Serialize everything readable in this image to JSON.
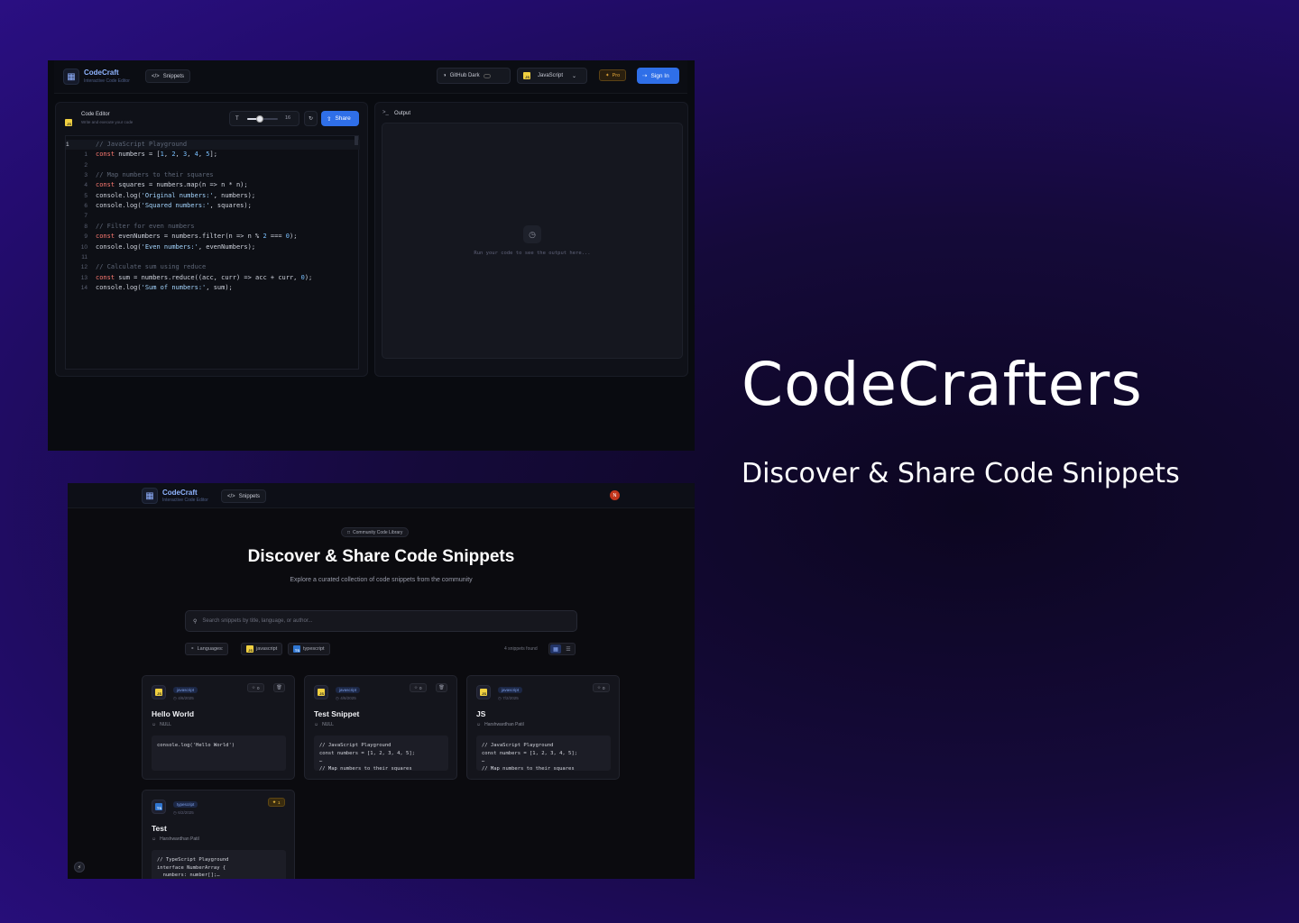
{
  "hero": {
    "title": "CodeCrafters",
    "subtitle": "Discover & Share Code Snippets"
  },
  "editor_app": {
    "brand": "CodeCraft",
    "brand_sub": "Interactive Code Editor",
    "nav_snippets": "Snippets",
    "theme": "GitHub Dark",
    "language": "JavaScript",
    "pro_label": "Pro",
    "sign_in": "Sign In",
    "editor_title": "Code Editor",
    "editor_sub": "Write and execute your code",
    "font_size": "16",
    "font_slider_level": 0.4,
    "share": "Share",
    "output_title": "Output",
    "output_placeholder": "Run your code to see the output here...",
    "cursor_line": "1",
    "code_lines": [
      {
        "n": "",
        "t": "// JavaScript Playground"
      },
      {
        "n": "1",
        "t": "const numbers = [1, 2, 3, 4, 5];"
      },
      {
        "n": "2",
        "t": ""
      },
      {
        "n": "3",
        "t": "// Map numbers to their squares"
      },
      {
        "n": "4",
        "t": "const squares = numbers.map(n => n * n);"
      },
      {
        "n": "5",
        "t": "console.log('Original numbers:', numbers);"
      },
      {
        "n": "6",
        "t": "console.log('Squared numbers:', squares);"
      },
      {
        "n": "7",
        "t": ""
      },
      {
        "n": "8",
        "t": "// Filter for even numbers"
      },
      {
        "n": "9",
        "t": "const evenNumbers = numbers.filter(n => n % 2 === 0);"
      },
      {
        "n": "10",
        "t": "console.log('Even numbers:', evenNumbers);"
      },
      {
        "n": "11",
        "t": ""
      },
      {
        "n": "12",
        "t": "// Calculate sum using reduce"
      },
      {
        "n": "13",
        "t": "const sum = numbers.reduce((acc, curr) => acc + curr, 0);"
      },
      {
        "n": "14",
        "t": "console.log('Sum of numbers:', sum);"
      }
    ]
  },
  "snippets_app": {
    "brand": "CodeCraft",
    "brand_sub": "Interactive Code Editor",
    "nav_snippets": "Snippets",
    "avatar_initial": "N",
    "badge": "Community Code Library",
    "title": "Discover & Share Code Snippets",
    "subtitle": "Explore a curated collection of code snippets from the community",
    "search_placeholder": "Search snippets by title, language, or author...",
    "languages_label": "Languages:",
    "lang_filters": [
      "javascript",
      "typescript"
    ],
    "count": "4 snippets found",
    "cards": [
      {
        "lang": "javascript",
        "date": "4/6/2025",
        "stars": "0",
        "starred": false,
        "deletable": true,
        "title": "Hello World",
        "author": "NULL",
        "code": "console.log('Hello World')"
      },
      {
        "lang": "javascript",
        "date": "4/6/2025",
        "stars": "0",
        "starred": false,
        "deletable": true,
        "title": "Test Snippet",
        "author": "NULL",
        "code": "// JavaScript Playground\nconst numbers = [1, 2, 3, 4, 5];\n…\n// Map numbers to their squares"
      },
      {
        "lang": "javascript",
        "date": "7/2/2025",
        "stars": "0",
        "starred": false,
        "deletable": false,
        "title": "JS",
        "author": "Harshwardhan Patil",
        "code": "// JavaScript Playground\nconst numbers = [1, 2, 3, 4, 5];\n…\n// Map numbers to their squares"
      },
      {
        "lang": "typescript",
        "date": "6/2/2025",
        "stars": "1",
        "starred": true,
        "deletable": false,
        "title": "Test",
        "author": "Harshwardhan Patil",
        "code": "// TypeScript Playground\ninterface NumberArray {\n  numbers: number[];…"
      }
    ]
  },
  "colors": {
    "accent": "#2f6fe8",
    "keyword": "#ff7b72",
    "string": "#a5d6ff",
    "number": "#79c0ff",
    "comment": "#5e6778"
  }
}
